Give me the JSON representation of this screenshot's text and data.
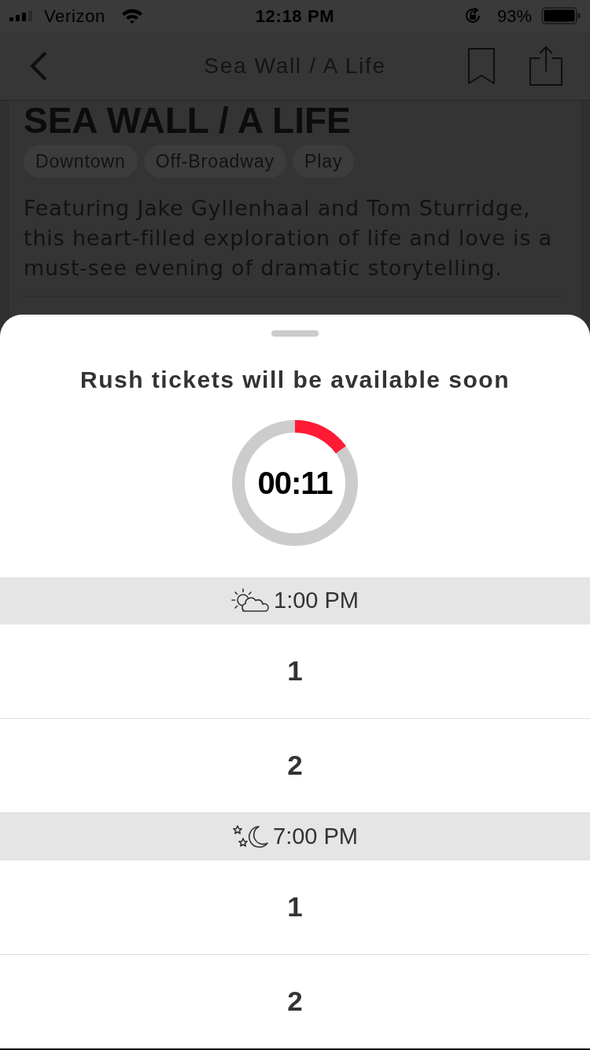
{
  "status_bar": {
    "carrier": "Verizon",
    "time": "12:18 PM",
    "battery": "93%"
  },
  "nav_bar": {
    "title": "Sea Wall / A Life"
  },
  "show": {
    "heading": "SEA WALL / A LIFE",
    "tags": [
      "Downtown",
      "Off-Broadway",
      "Play"
    ],
    "description": "Featuring Jake Gyllenhaal and Tom Sturridge, this heart-filled exploration of life and love is a must-see evening of dramatic storytelling."
  },
  "sheet": {
    "title": "Rush tickets will be available soon",
    "countdown": {
      "time": "00:11",
      "level": 0.15
    },
    "sessions": [
      {
        "time": "1:00 PM",
        "kind": "day",
        "options": [
          "1",
          "2"
        ]
      },
      {
        "time": "7:00 PM",
        "kind": "night",
        "options": [
          "1",
          "2"
        ]
      }
    ]
  }
}
